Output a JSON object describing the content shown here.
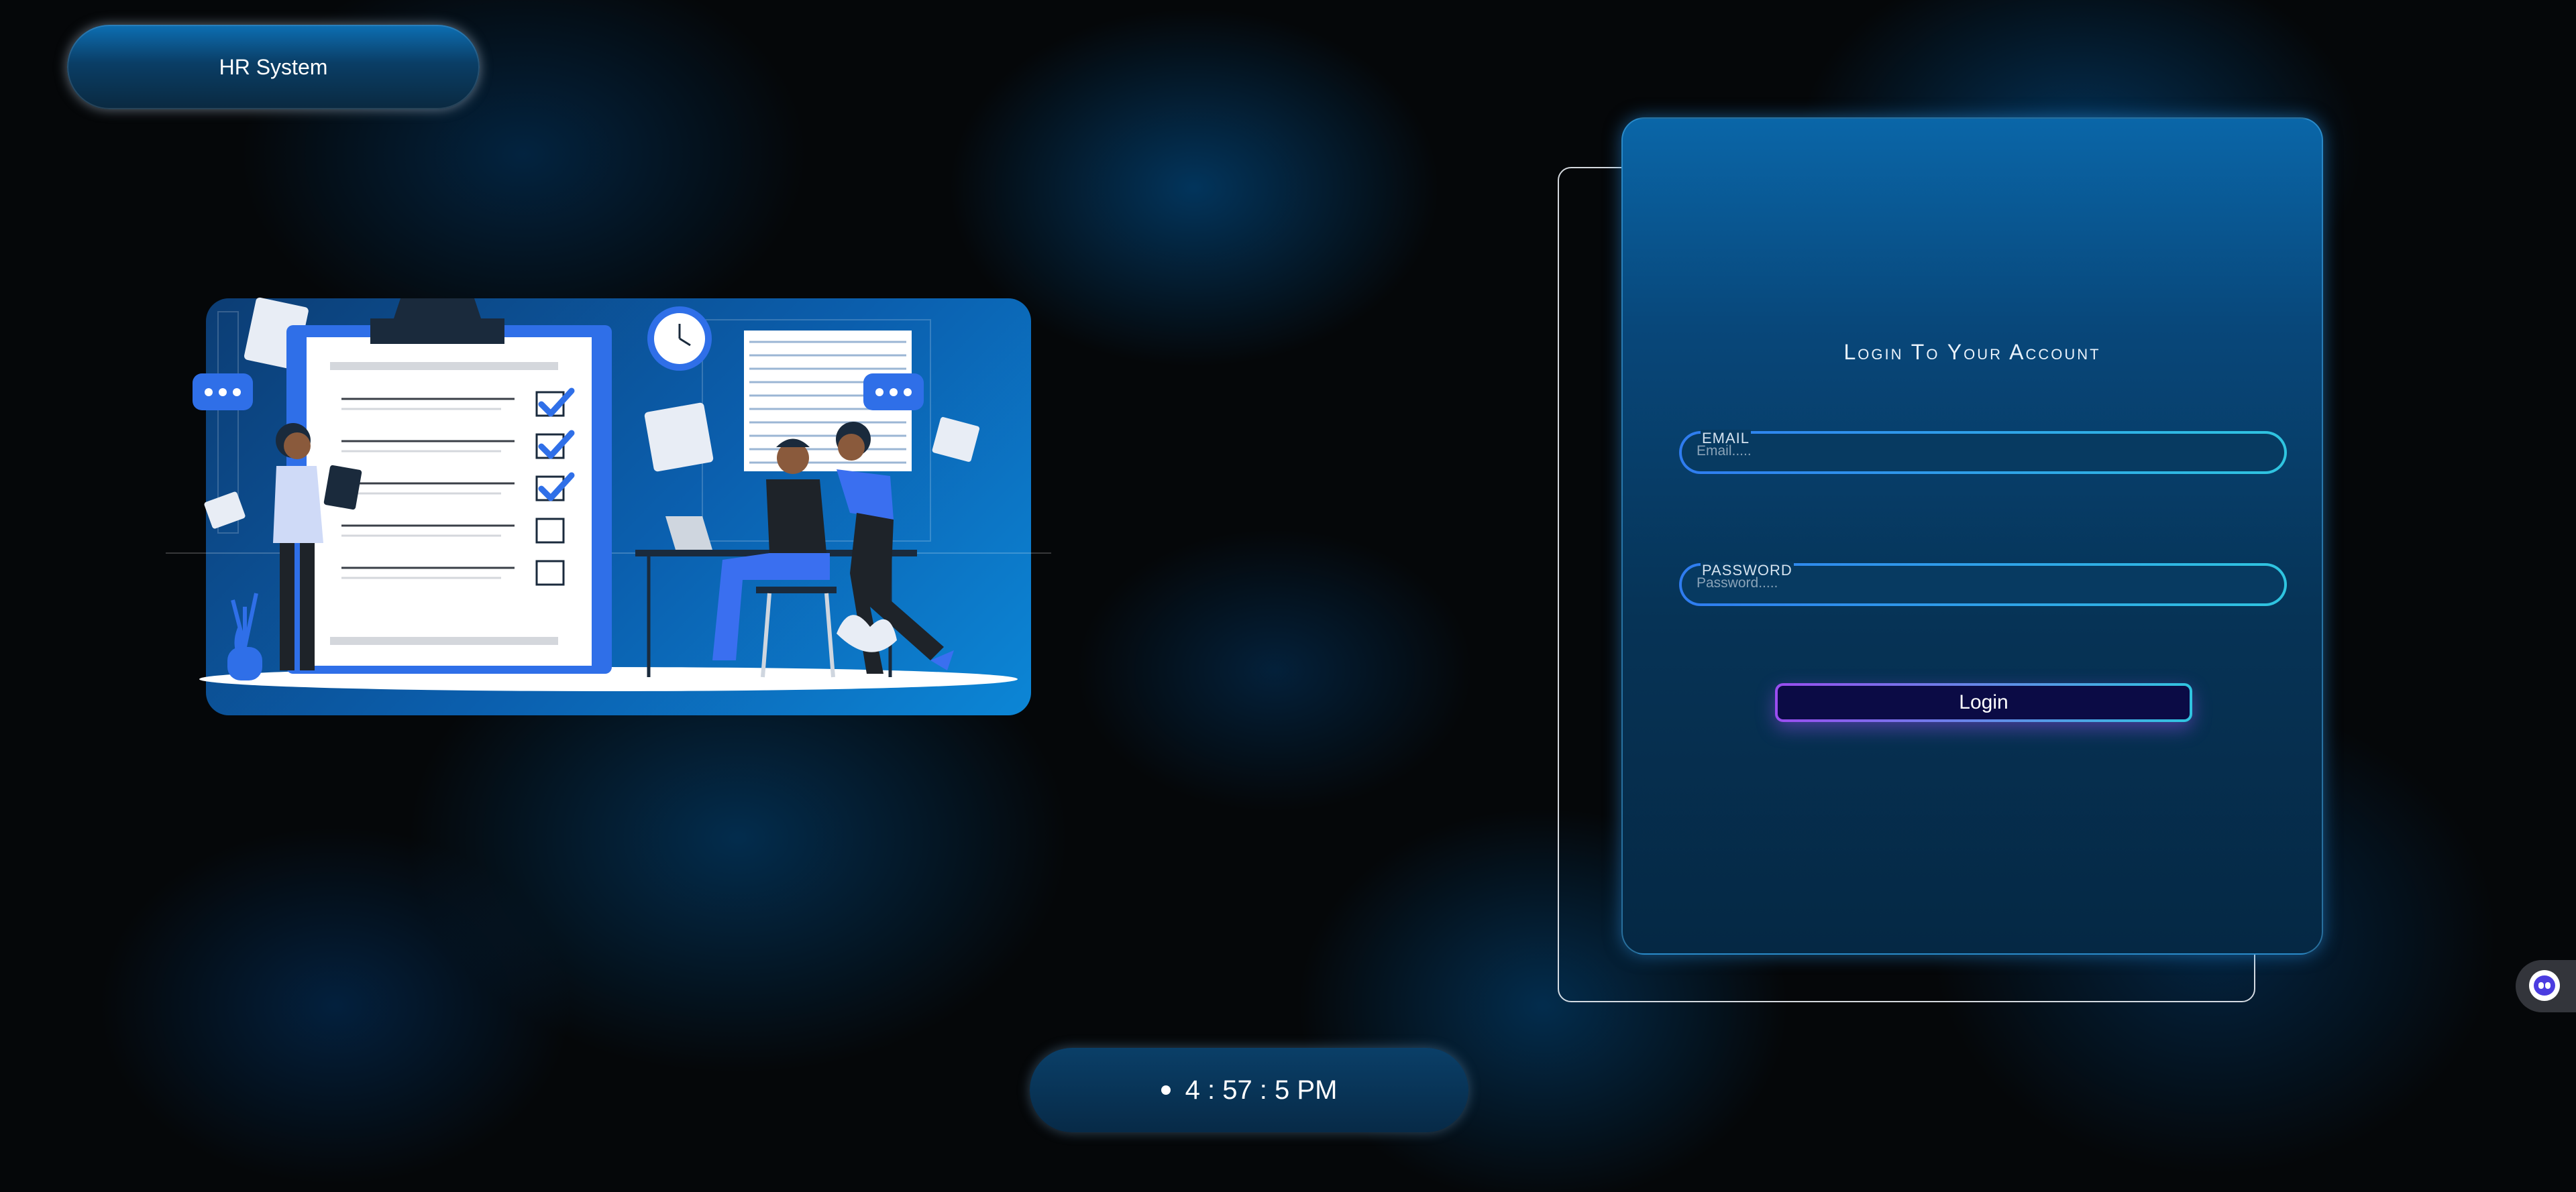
{
  "header": {
    "app_title": "HR System"
  },
  "login": {
    "title": "Login To Your Account",
    "email": {
      "label": "EMAIL",
      "placeholder": "Email.....",
      "value": ""
    },
    "password": {
      "label": "PASSWORD",
      "placeholder": "Password.....",
      "value": ""
    },
    "submit_label": "Login"
  },
  "clock": {
    "time": "4 : 57 : 5 PM"
  },
  "widget": {
    "icon": "assistant-bot-icon"
  },
  "illustration": {
    "icon": "hr-team-checklist-illustration"
  },
  "colors": {
    "accent_blue": "#2f7cf0",
    "accent_cyan": "#2fc5e0",
    "accent_purple": "#9a4df0",
    "card_top": "#0a66a8",
    "background": "#050709"
  }
}
